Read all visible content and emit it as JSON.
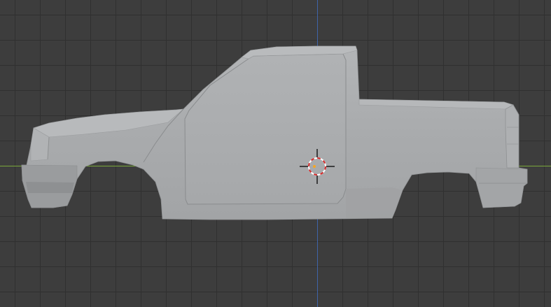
{
  "viewport": {
    "background": "#3d3d3d",
    "grid_color": "#303030",
    "x_axis_color": "#7aa83a",
    "y_axis_color": "#3f64a8"
  },
  "object": {
    "kind": "pickup-truck-body-mesh",
    "view": "side-orthographic",
    "shading": "solid",
    "base_color": "#a9abad"
  },
  "cursor_3d": {
    "icon": "3d-cursor-icon",
    "ring_colors": [
      "#ffffff",
      "#d42a2a"
    ]
  }
}
